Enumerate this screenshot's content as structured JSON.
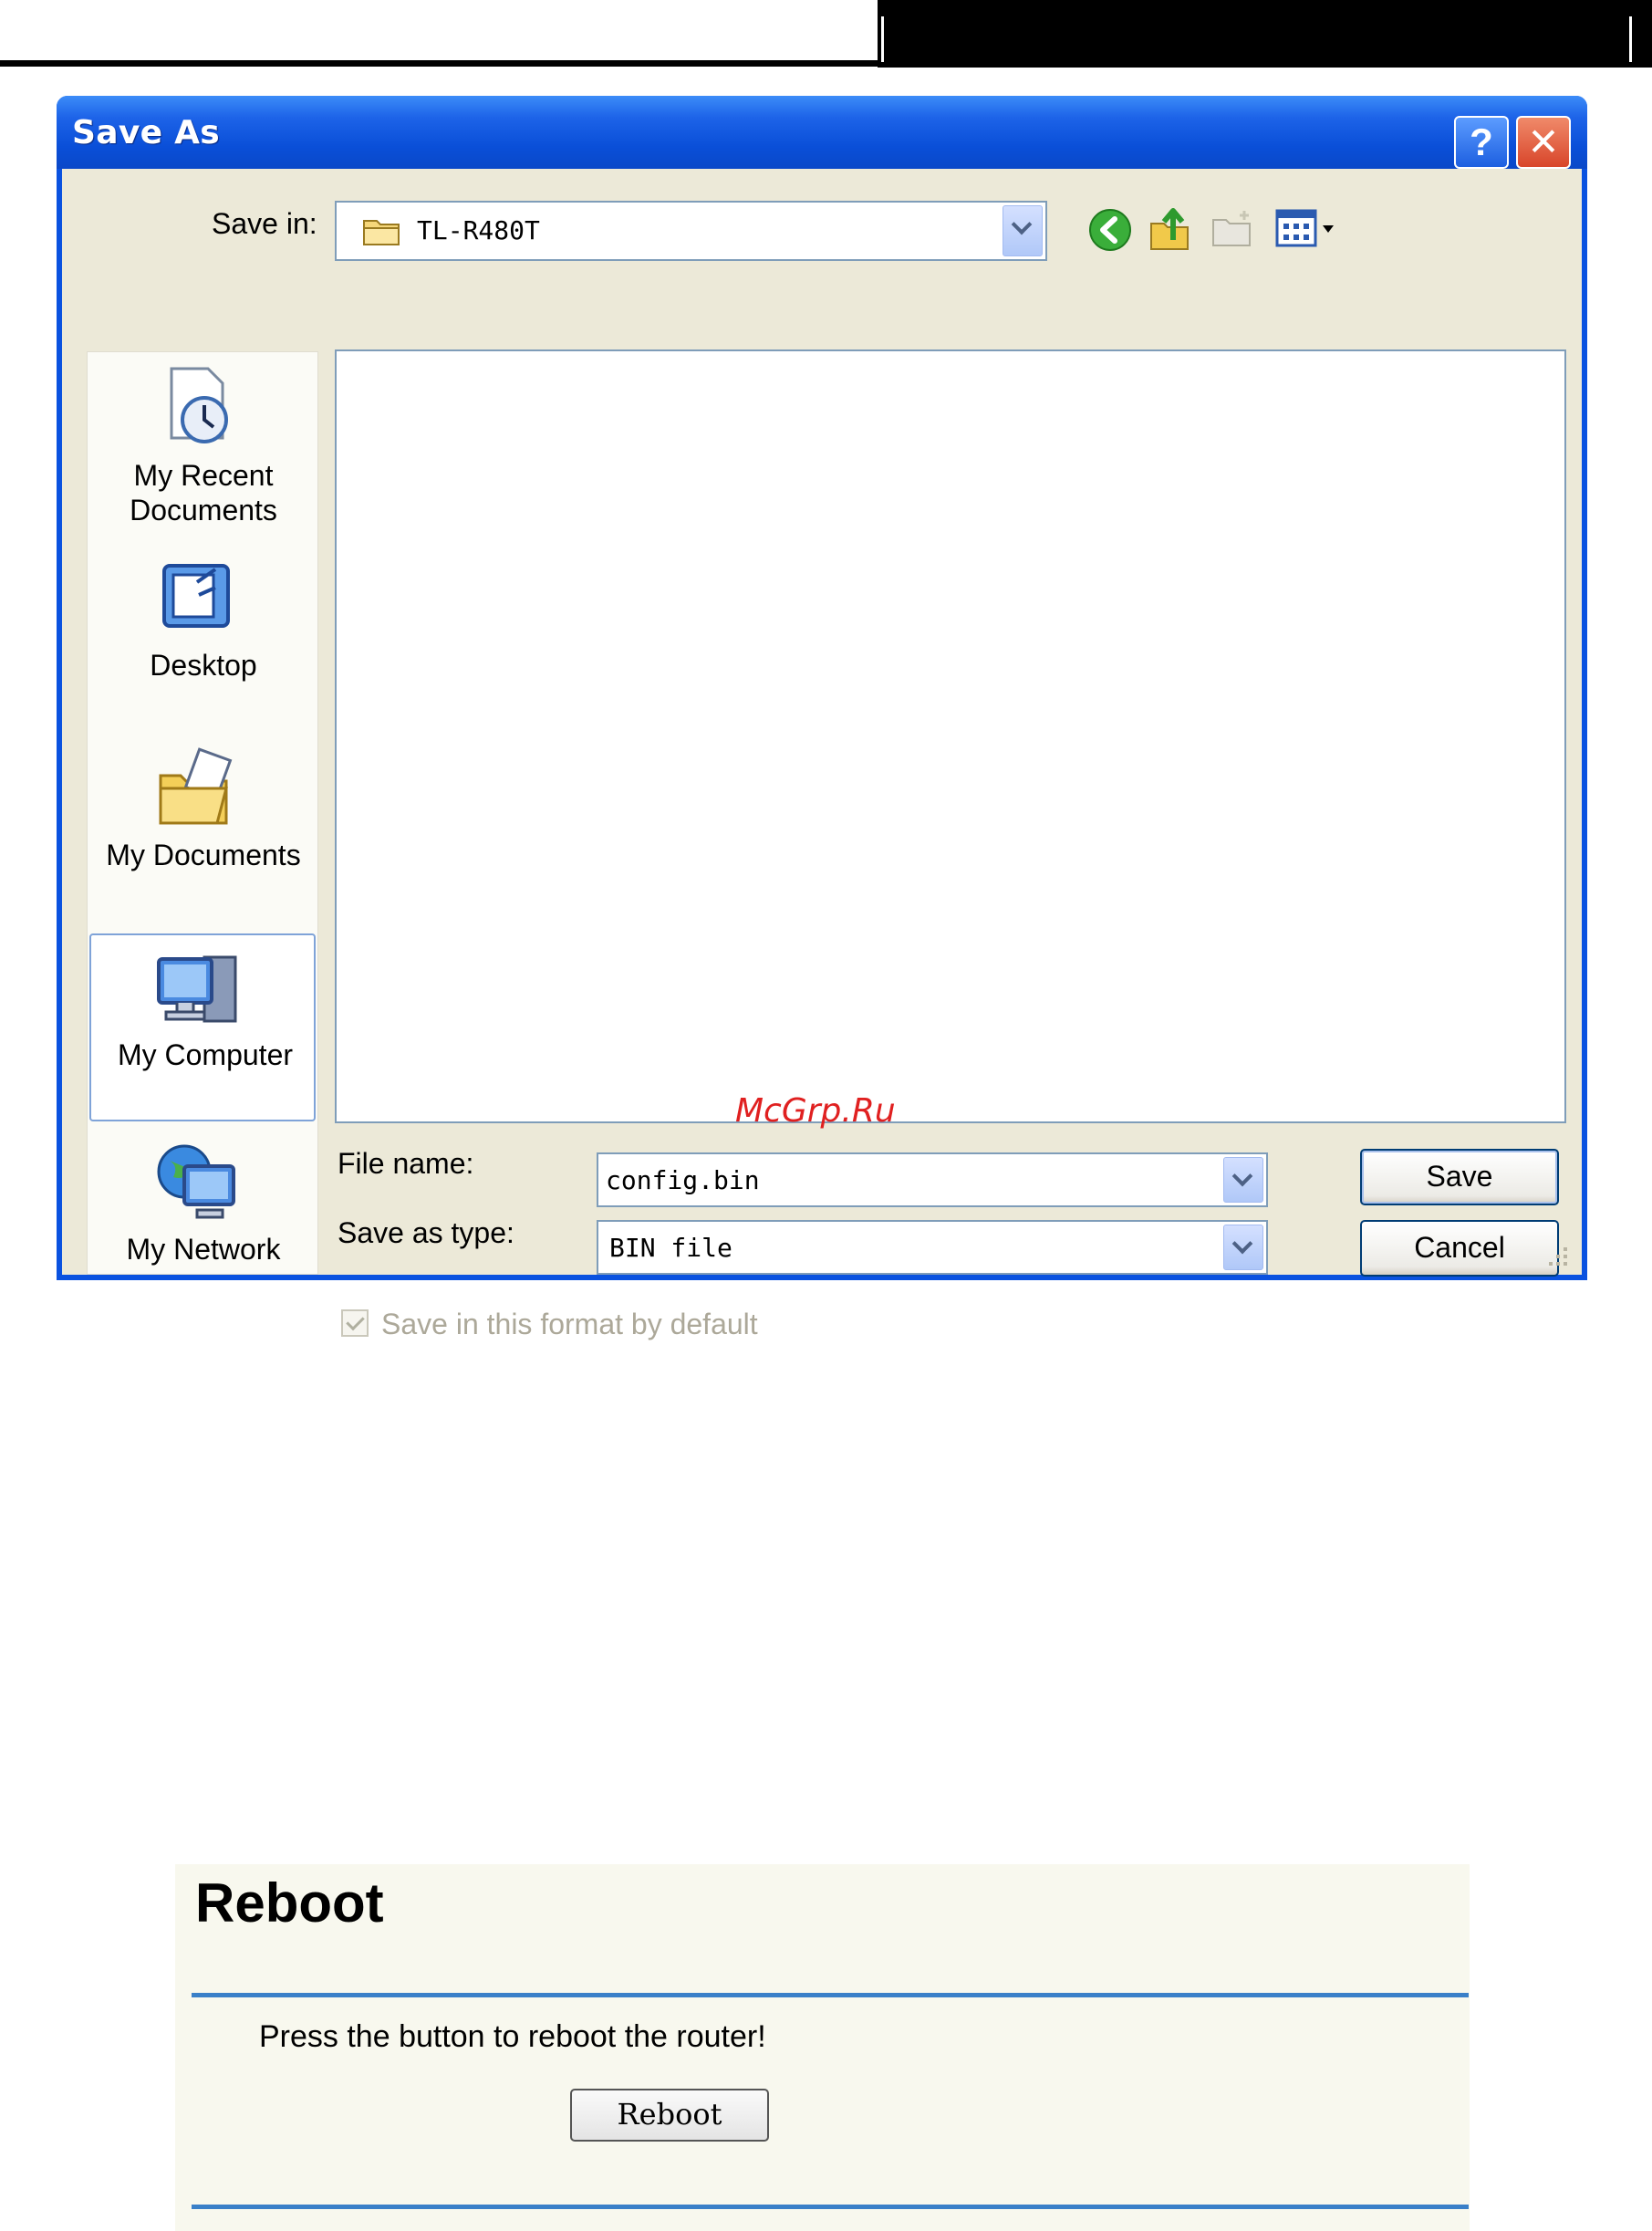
{
  "dialog": {
    "title": "Save As",
    "help_label": "?",
    "close_label": "✕",
    "save_in_label": "Save in:",
    "save_in_value": "TL-R480T",
    "places": [
      {
        "label_line1": "My Recent",
        "label_line2": "Documents",
        "icon": "recent-documents-icon"
      },
      {
        "label_line1": "Desktop",
        "label_line2": "",
        "icon": "desktop-icon"
      },
      {
        "label_line1": "My Documents",
        "label_line2": "",
        "icon": "my-documents-icon"
      },
      {
        "label_line1": "My Computer",
        "label_line2": "",
        "icon": "my-computer-icon"
      },
      {
        "label_line1": "My Network",
        "label_line2": "",
        "icon": "my-network-icon"
      }
    ],
    "file_name_label": "File name:",
    "file_name_value": "config.bin",
    "save_as_type_label": "Save as type:",
    "save_as_type_value": "BIN file",
    "save_button": "Save",
    "cancel_button": "Cancel",
    "default_format_label": "Save in this format by default",
    "default_format_checked": true
  },
  "watermark": "McGrp.Ru",
  "reboot": {
    "title": "Reboot",
    "instruction": "Press the button to reboot the router!",
    "button": "Reboot"
  }
}
